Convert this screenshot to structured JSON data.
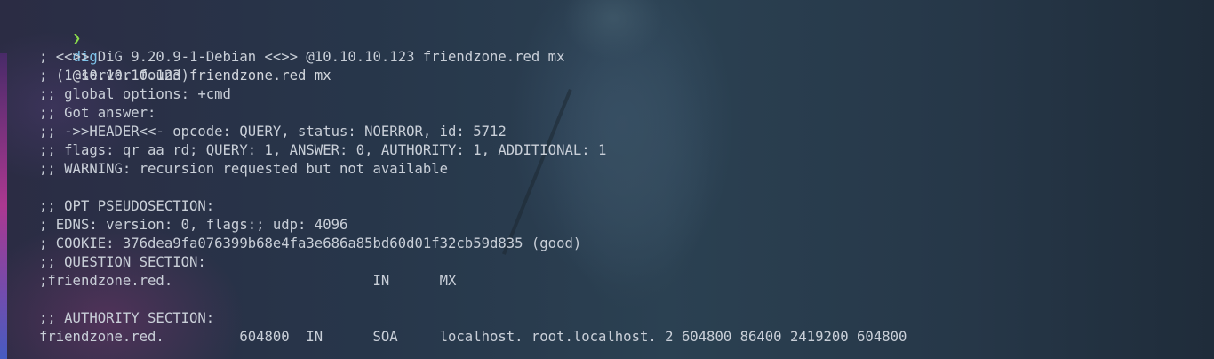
{
  "terminal": {
    "prompt": {
      "symbol": "❯",
      "command": "dig",
      "args": "@10.10.10.123 friendzone.red mx"
    },
    "output_lines": [
      "; <<>> DiG 9.20.9-1-Debian <<>> @10.10.10.123 friendzone.red mx",
      "; (1 server found)",
      ";; global options: +cmd",
      ";; Got answer:",
      ";; ->>HEADER<<- opcode: QUERY, status: NOERROR, id: 5712",
      ";; flags: qr aa rd; QUERY: 1, ANSWER: 0, AUTHORITY: 1, ADDITIONAL: 1",
      ";; WARNING: recursion requested but not available",
      "",
      ";; OPT PSEUDOSECTION:",
      "; EDNS: version: 0, flags:; udp: 4096",
      "; COOKIE: 376dea9fa076399b68e4fa3e686a85bd60d01f32cb59d835 (good)",
      ";; QUESTION SECTION:",
      ";friendzone.red.                        IN      MX",
      "",
      ";; AUTHORITY SECTION:",
      "friendzone.red.         604800  IN      SOA     localhost. root.localhost. 2 604800 86400 2419200 604800"
    ]
  },
  "colors": {
    "prompt_symbol": "#8bdc4c",
    "command": "#7fc4ea",
    "text": "#c9cfd8"
  }
}
